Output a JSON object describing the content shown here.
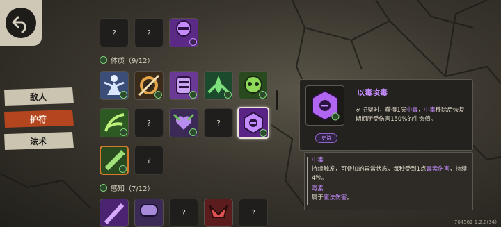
{
  "nav": {
    "back_icon": "back-arrow-icon"
  },
  "tabs": [
    {
      "label": "敌人",
      "active": false
    },
    {
      "label": "护符",
      "active": true
    },
    {
      "label": "法术",
      "active": false
    }
  ],
  "sections": [
    {
      "label": "体质（9/12）",
      "icon": "shield-icon"
    },
    {
      "label": "感知（7/12）",
      "icon": "shield-icon"
    }
  ],
  "unknown_mark": "?",
  "slots": {
    "top_row": [
      {
        "state": "locked",
        "icon": "unknown"
      },
      {
        "state": "locked",
        "icon": "unknown"
      },
      {
        "state": "owned",
        "icon": "purple-mask-charm-icon"
      }
    ],
    "row1": [
      {
        "state": "owned",
        "icon": "blue-spirit-charm-icon"
      },
      {
        "state": "owned",
        "icon": "golden-gear-charm-icon"
      },
      {
        "state": "owned",
        "icon": "purple-armor-charm-icon"
      },
      {
        "state": "owned",
        "icon": "green-leaf-charm-icon"
      },
      {
        "state": "owned",
        "icon": "green-skull-charm-icon"
      }
    ],
    "row2": [
      {
        "state": "owned",
        "icon": "green-claw-charm-icon"
      },
      {
        "state": "locked",
        "icon": "unknown"
      },
      {
        "state": "owned",
        "icon": "purple-heart-charm-icon"
      },
      {
        "state": "locked",
        "icon": "unknown"
      },
      {
        "state": "selected",
        "icon": "purple-toxin-charm-icon"
      }
    ],
    "row3": [
      {
        "state": "owned",
        "icon": "green-syringe-charm-icon"
      },
      {
        "state": "locked",
        "icon": "unknown"
      }
    ],
    "row4": [
      {
        "state": "owned",
        "icon": "purple-blade-charm-icon"
      },
      {
        "state": "owned",
        "icon": "purple-helmet-charm-icon"
      },
      {
        "state": "locked",
        "icon": "unknown"
      },
      {
        "state": "owned",
        "icon": "red-horn-charm-icon"
      },
      {
        "state": "locked",
        "icon": "unknown"
      }
    ]
  },
  "detail": {
    "title": "以毒攻毒",
    "desc_prefix": "招架时，获得1层",
    "desc_hl1": "中毒",
    "desc_sep": "，",
    "desc_hl2": "中毒",
    "desc_suffix": "移除后恢复期间所受伤害150%的生命值。",
    "rarity": "史诗",
    "icon": "purple-toxin-charm-icon"
  },
  "glossary": {
    "term1": "中毒",
    "term1_desc_a": "持续触发，可叠加的异常状态，每秒受到1点",
    "term1_desc_hl": "毒素伤害",
    "term1_desc_b": "，持续4秒。",
    "term2": "毒素",
    "term2_desc_a": "属于",
    "term2_desc_hl": "魔法伤害",
    "term2_desc_b": "。"
  },
  "version": "704562 1.2.0(34)",
  "colors": {
    "accent": "#c48cff",
    "active_tab": "#b3461f",
    "badge_green": "#7fcf7a"
  }
}
